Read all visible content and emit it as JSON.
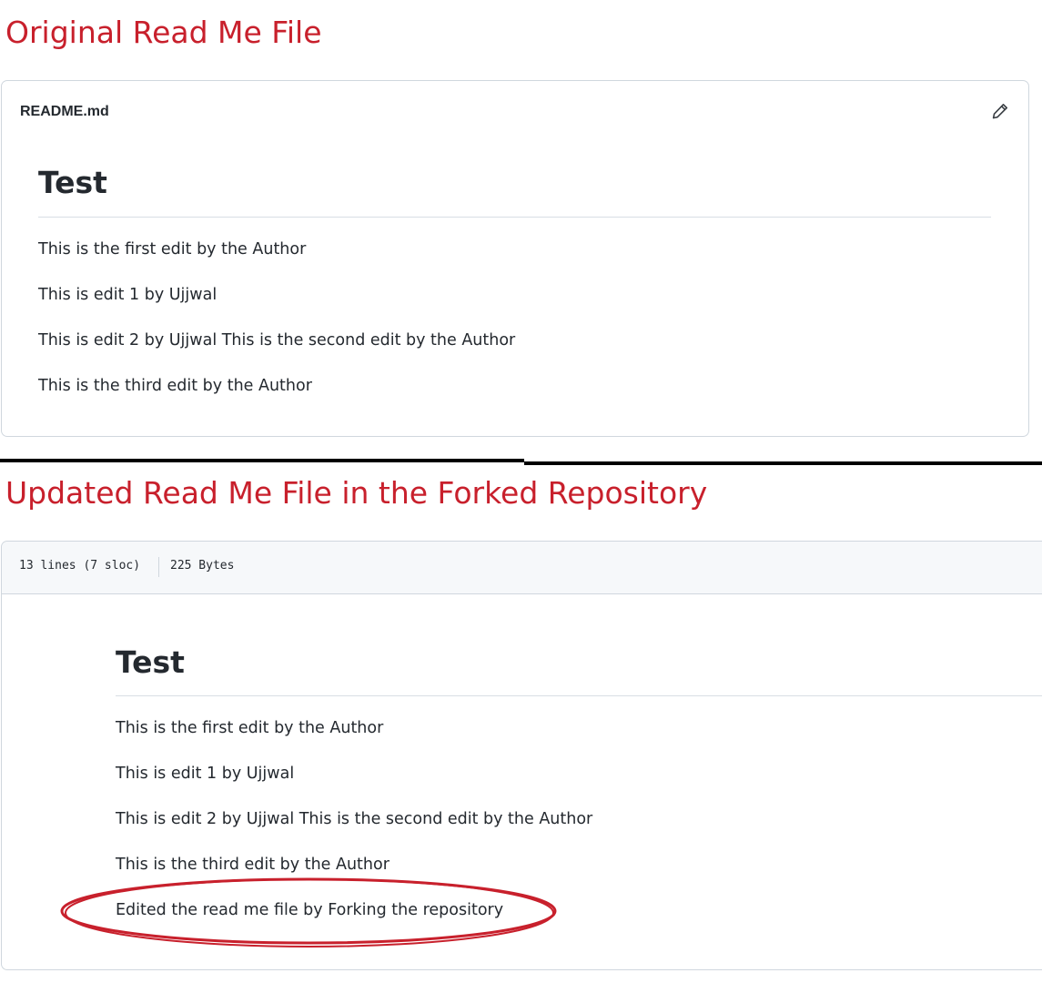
{
  "captions": {
    "original": "Original Read Me File",
    "updated": "Updated Read Me File in the Forked Repository"
  },
  "original_readme": {
    "file_name": "README.md",
    "edit_icon": "pencil-icon",
    "title": "Test",
    "paragraphs": [
      "This is the first edit by the Author",
      "This is edit 1 by Ujjwal",
      "This is edit 2 by Ujjwal This is the second edit by the Author",
      "This is the third edit by the Author"
    ]
  },
  "updated_readme": {
    "lines_info": "13 lines (7 sloc)",
    "size_info": "225 Bytes",
    "title": "Test",
    "paragraphs": [
      "This is the first edit by the Author",
      "This is edit 1 by Ujjwal",
      "This is edit 2 by Ujjwal This is the second edit by the Author",
      "This is the third edit by the Author",
      "Edited the read me file by Forking the repository"
    ]
  },
  "colors": {
    "caption": "#c8202c",
    "highlight": "#c8202c",
    "border": "#d0d7de",
    "text": "#24292f",
    "header_bg": "#f6f8fa"
  }
}
